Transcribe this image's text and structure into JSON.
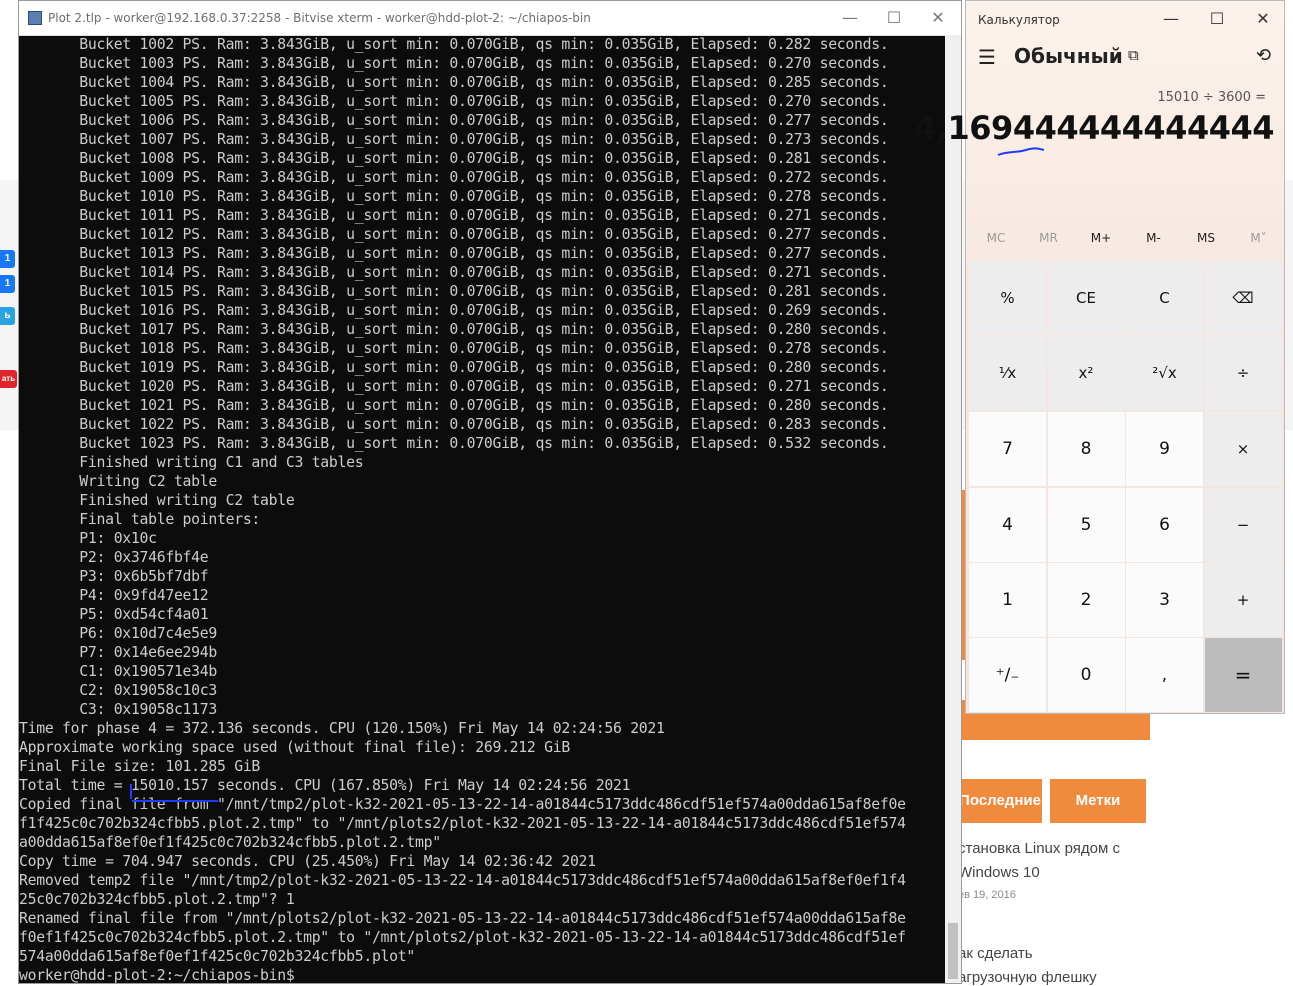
{
  "terminal": {
    "title": "Plot 2.tlp - worker@192.168.0.37:2258 - Bitvise xterm - worker@hdd-plot-2: ~/chiapos-bin",
    "lines": [
      "       Bucket 1002 PS. Ram: 3.843GiB, u_sort min: 0.070GiB, qs min: 0.035GiB, Elapsed: 0.282 seconds.",
      "       Bucket 1003 PS. Ram: 3.843GiB, u_sort min: 0.070GiB, qs min: 0.035GiB, Elapsed: 0.270 seconds.",
      "       Bucket 1004 PS. Ram: 3.843GiB, u_sort min: 0.070GiB, qs min: 0.035GiB, Elapsed: 0.285 seconds.",
      "       Bucket 1005 PS. Ram: 3.843GiB, u_sort min: 0.070GiB, qs min: 0.035GiB, Elapsed: 0.270 seconds.",
      "       Bucket 1006 PS. Ram: 3.843GiB, u_sort min: 0.070GiB, qs min: 0.035GiB, Elapsed: 0.277 seconds.",
      "       Bucket 1007 PS. Ram: 3.843GiB, u_sort min: 0.070GiB, qs min: 0.035GiB, Elapsed: 0.273 seconds.",
      "       Bucket 1008 PS. Ram: 3.843GiB, u_sort min: 0.070GiB, qs min: 0.035GiB, Elapsed: 0.281 seconds.",
      "       Bucket 1009 PS. Ram: 3.843GiB, u_sort min: 0.070GiB, qs min: 0.035GiB, Elapsed: 0.272 seconds.",
      "       Bucket 1010 PS. Ram: 3.843GiB, u_sort min: 0.070GiB, qs min: 0.035GiB, Elapsed: 0.278 seconds.",
      "       Bucket 1011 PS. Ram: 3.843GiB, u_sort min: 0.070GiB, qs min: 0.035GiB, Elapsed: 0.271 seconds.",
      "       Bucket 1012 PS. Ram: 3.843GiB, u_sort min: 0.070GiB, qs min: 0.035GiB, Elapsed: 0.277 seconds.",
      "       Bucket 1013 PS. Ram: 3.843GiB, u_sort min: 0.070GiB, qs min: 0.035GiB, Elapsed: 0.277 seconds.",
      "       Bucket 1014 PS. Ram: 3.843GiB, u_sort min: 0.070GiB, qs min: 0.035GiB, Elapsed: 0.271 seconds.",
      "       Bucket 1015 PS. Ram: 3.843GiB, u_sort min: 0.070GiB, qs min: 0.035GiB, Elapsed: 0.281 seconds.",
      "       Bucket 1016 PS. Ram: 3.843GiB, u_sort min: 0.070GiB, qs min: 0.035GiB, Elapsed: 0.269 seconds.",
      "       Bucket 1017 PS. Ram: 3.843GiB, u_sort min: 0.070GiB, qs min: 0.035GiB, Elapsed: 0.280 seconds.",
      "       Bucket 1018 PS. Ram: 3.843GiB, u_sort min: 0.070GiB, qs min: 0.035GiB, Elapsed: 0.278 seconds.",
      "       Bucket 1019 PS. Ram: 3.843GiB, u_sort min: 0.070GiB, qs min: 0.035GiB, Elapsed: 0.280 seconds.",
      "       Bucket 1020 PS. Ram: 3.843GiB, u_sort min: 0.070GiB, qs min: 0.035GiB, Elapsed: 0.271 seconds.",
      "       Bucket 1021 PS. Ram: 3.843GiB, u_sort min: 0.070GiB, qs min: 0.035GiB, Elapsed: 0.280 seconds.",
      "       Bucket 1022 PS. Ram: 3.843GiB, u_sort min: 0.070GiB, qs min: 0.035GiB, Elapsed: 0.283 seconds.",
      "       Bucket 1023 PS. Ram: 3.843GiB, u_sort min: 0.070GiB, qs min: 0.035GiB, Elapsed: 0.532 seconds.",
      "       Finished writing C1 and C3 tables",
      "       Writing C2 table",
      "       Finished writing C2 table",
      "       Final table pointers:",
      "       P1: 0x10c",
      "       P2: 0x3746fbf4e",
      "       P3: 0x6b5bf7dbf",
      "       P4: 0x9fd47ee12",
      "       P5: 0xd54cf4a01",
      "       P6: 0x10d7c4e5e9",
      "       P7: 0x14e6ee294b",
      "       C1: 0x190571e34b",
      "       C2: 0x19058c10c3",
      "       C3: 0x19058c1173",
      "Time for phase 4 = 372.136 seconds. CPU (120.150%) Fri May 14 02:24:56 2021",
      "Approximate working space used (without final file): 269.212 GiB",
      "Final File size: 101.285 GiB",
      "Total time = 15010.157 seconds. CPU (167.850%) Fri May 14 02:24:56 2021",
      "Copied final file from \"/mnt/tmp2/plot-k32-2021-05-13-22-14-a01844c5173ddc486cdf51ef574a00dda615af8ef0e",
      "f1f425c0c702b324cfbb5.plot.2.tmp\" to \"/mnt/plots2/plot-k32-2021-05-13-22-14-a01844c5173ddc486cdf51ef574",
      "a00dda615af8ef0ef1f425c0c702b324cfbb5.plot.2.tmp\"",
      "Copy time = 704.947 seconds. CPU (25.450%) Fri May 14 02:36:42 2021",
      "Removed temp2 file \"/mnt/tmp2/plot-k32-2021-05-13-22-14-a01844c5173ddc486cdf51ef574a00dda615af8ef0ef1f4",
      "25c0c702b324cfbb5.plot.2.tmp\"? 1",
      "Renamed final file from \"/mnt/plots2/plot-k32-2021-05-13-22-14-a01844c5173ddc486cdf51ef574a00dda615af8e",
      "f0ef1f425c0c702b324cfbb5.plot.2.tmp\" to \"/mnt/plots2/plot-k32-2021-05-13-22-14-a01844c5173ddc486cdf51ef",
      "574a00dda615af8ef0ef1f425c0c702b324cfbb5.plot\"",
      "worker@hdd-plot-2:~/chiapos-bin$"
    ]
  },
  "calculator": {
    "title": "Калькулятор",
    "mode": "Обычный",
    "expression": "15010 ÷ 3600 =",
    "display": "4,169444444444444",
    "memory": [
      "MC",
      "MR",
      "M+",
      "M-",
      "MS",
      "M˅"
    ],
    "keys": [
      "%",
      "CE",
      "C",
      "⌫",
      "¹⁄x",
      "x²",
      "²√x",
      "÷",
      "7",
      "8",
      "9",
      "×",
      "4",
      "5",
      "6",
      "−",
      "1",
      "2",
      "3",
      "+",
      "⁺∕₋",
      "0",
      ",",
      "="
    ]
  },
  "background_page": {
    "tabs": [
      "Последние",
      "Метки"
    ],
    "links": [
      "становка Linux рядом с",
      "Windows 10",
      "ак сделать",
      "агрузочную флешку"
    ],
    "date": "ев 19, 2016",
    "side_buttons": [
      "1",
      "1",
      "ь",
      "ать"
    ]
  },
  "colors": {
    "terminal_bg": "#0c0c0c",
    "terminal_fg": "#cccccc",
    "accent_orange": "#f08a3c",
    "ink_blue": "#1d3cff"
  }
}
